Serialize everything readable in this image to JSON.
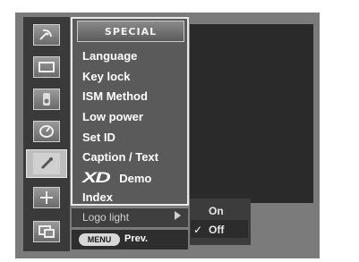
{
  "menu": {
    "title": "SPECIAL",
    "items": [
      {
        "label": "Language"
      },
      {
        "label": "Key lock"
      },
      {
        "label": "ISM Method"
      },
      {
        "label": "Low power"
      },
      {
        "label": "Set ID"
      },
      {
        "label": "Caption / Text"
      },
      {
        "logo": "XD",
        "label": "Demo"
      },
      {
        "label": "Index"
      }
    ],
    "logo_light": "Logo light"
  },
  "submenu": {
    "on": "On",
    "off": "Off",
    "checkmark": "✓"
  },
  "footer": {
    "menu_key": "MENU",
    "prev": "Prev."
  },
  "sidebar": {
    "icons": [
      "satellite-dish-icon",
      "screen-icon",
      "speaker-icon",
      "clock-icon",
      "special-icon",
      "plus-icon",
      "pip-icon"
    ],
    "active_index": 4
  }
}
